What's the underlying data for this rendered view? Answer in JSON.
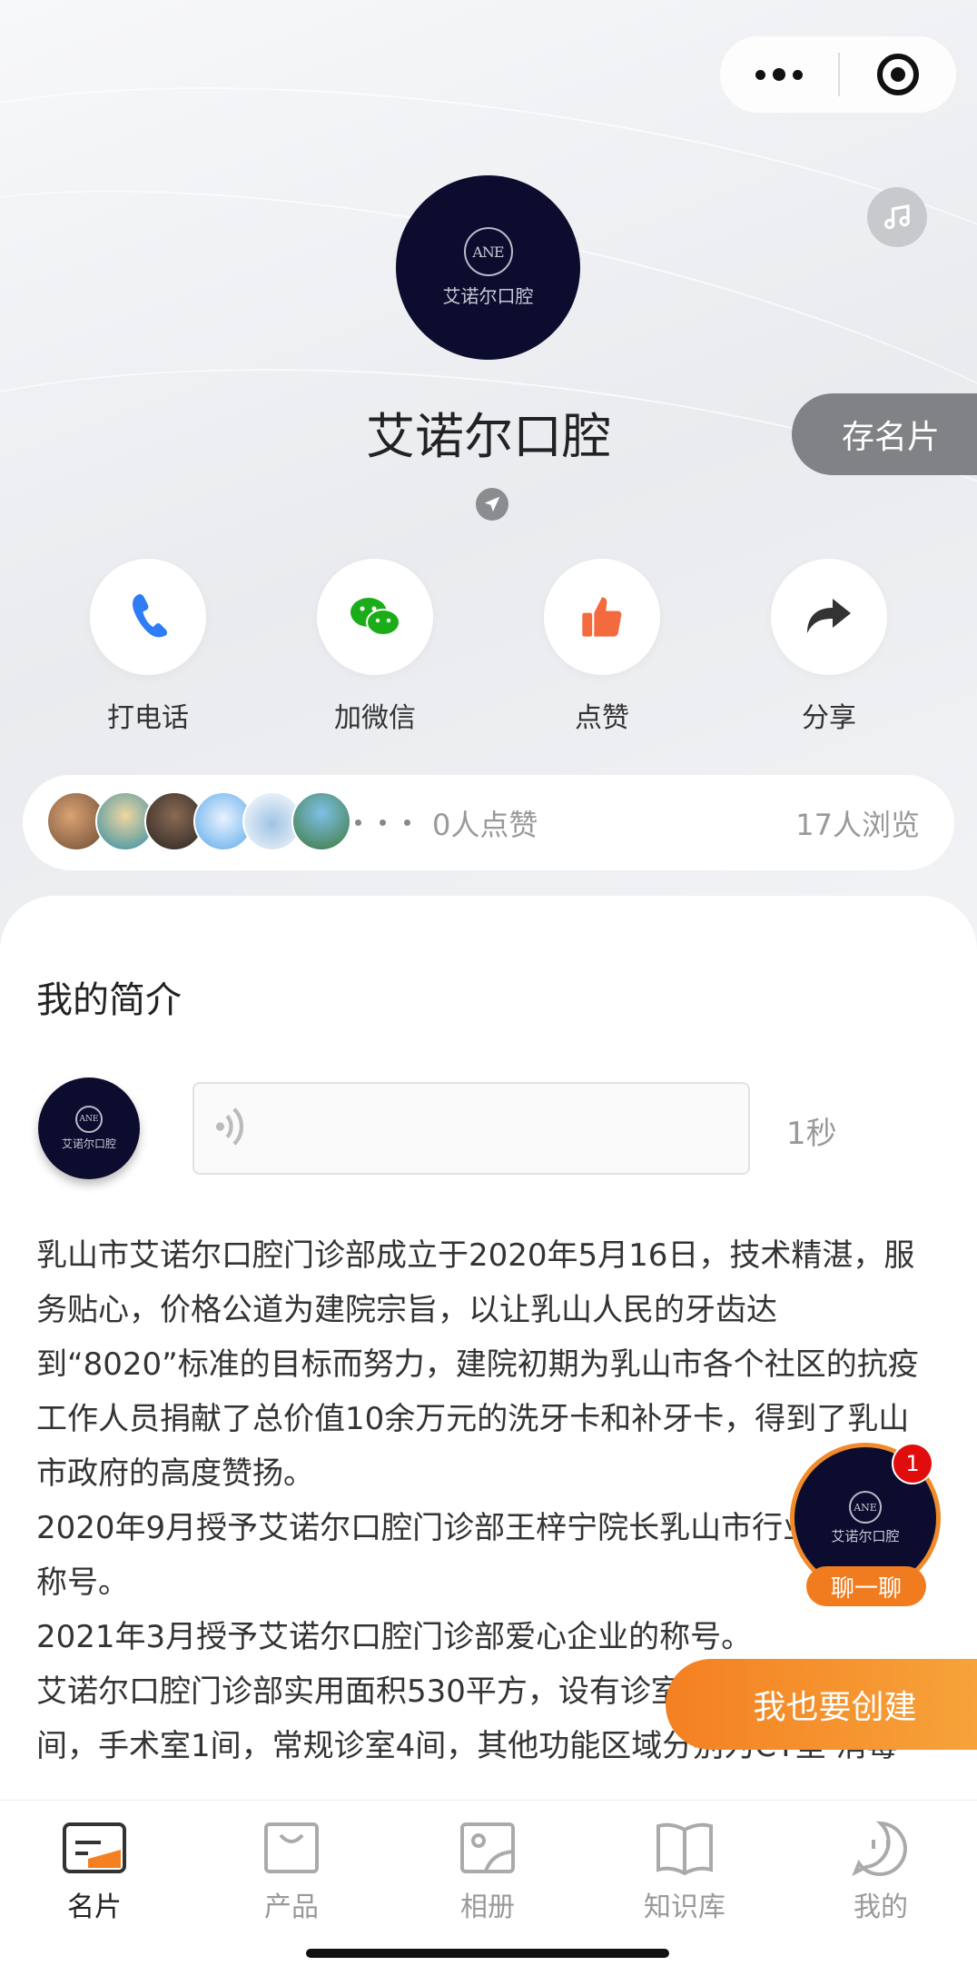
{
  "header": {
    "more_icon": "more-dots-icon",
    "close_icon": "target-circle-icon",
    "music_icon": "music-note-icon"
  },
  "profile": {
    "logo_mark": "ANE",
    "logo_text": "艾诺尔口腔",
    "name": "艾诺尔口腔",
    "save_card_label": "存名片",
    "location_icon": "location-arrow-icon"
  },
  "actions": [
    {
      "label": "打电话",
      "icon": "phone-icon",
      "color": "#2e7cf6"
    },
    {
      "label": "加微信",
      "icon": "wechat-icon",
      "color": "#1aad19"
    },
    {
      "label": "点赞",
      "icon": "thumbs-up-icon",
      "color": "#f26a3d"
    },
    {
      "label": "分享",
      "icon": "share-icon",
      "color": "#333333"
    }
  ],
  "stats": {
    "likes": "0人点赞",
    "views": "17人浏览"
  },
  "intro": {
    "title": "我的简介",
    "voice_duration": "1秒",
    "paragraphs": [
      "乳山市艾诺尔口腔门诊部成立于2020年5月16日，技术精湛，服务贴心，价格公道为建院宗旨，以让乳山人民的牙齿达到“8020”标准的目标而努力，建院初期为乳山市各个社区的抗疫工作人员捐献了总价值10余万元的洗牙卡和补牙卡，得到了乳山市政府的高度赞扬。",
      "2020年9月授予艾诺尔口腔门诊部王梓宁院长乳山市行业模范的称号。",
      "2021年3月授予艾诺尔口腔门诊部爱心企业的称号。",
      "艾诺尔口腔门诊部实用面积530平方，设有诊室10间，儿童诊室1间，手术室1间，常规诊室4间，其他功能区域分别为CT室 消毒室"
    ]
  },
  "chat": {
    "badge": "1",
    "label": "聊一聊"
  },
  "create_button": "我也要创建",
  "tabs": [
    {
      "label": "名片",
      "icon": "card-icon",
      "active": true
    },
    {
      "label": "产品",
      "icon": "bag-icon",
      "active": false
    },
    {
      "label": "相册",
      "icon": "photo-icon",
      "active": false
    },
    {
      "label": "知识库",
      "icon": "book-icon",
      "active": false
    },
    {
      "label": "我的",
      "icon": "face-icon",
      "active": false
    }
  ],
  "colors": {
    "accent_orange": "#f48022",
    "logo_navy": "#0c0d2e",
    "badge_red": "#e10d0d"
  }
}
